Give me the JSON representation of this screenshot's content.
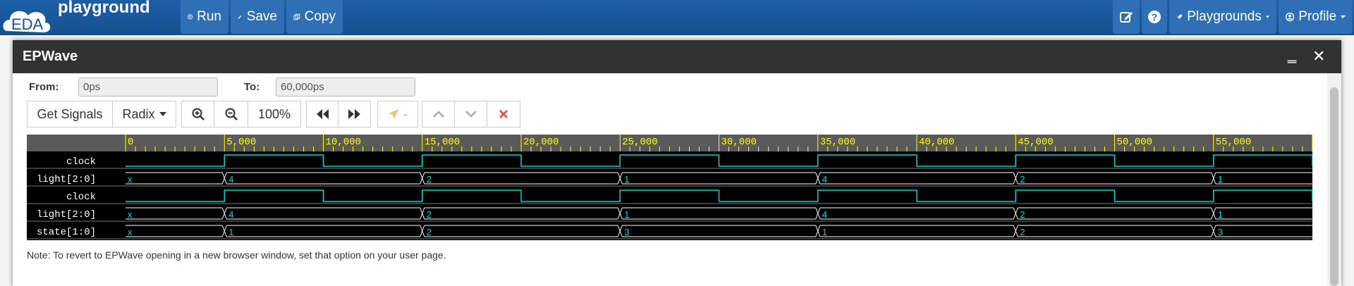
{
  "navbar": {
    "logo_text": "EDA",
    "logo_word": "playground",
    "run_label": "Run",
    "save_label": "Save",
    "copy_label": "Copy",
    "playgrounds_label": "Playgrounds",
    "profile_label": "Profile"
  },
  "modal": {
    "title": "EPWave",
    "minimize_glyph": "‗",
    "close_glyph": "✕",
    "from_label": "From:",
    "from_value": "0ps",
    "to_label": "To:",
    "to_value": "60,000ps",
    "get_signals_label": "Get Signals",
    "radix_label": "Radix",
    "zoom_value": "100%",
    "marker_label": "-",
    "note": "Note: To revert to EPWave opening in a new browser window, set that option on your user page."
  },
  "waveform": {
    "time_max": 60000,
    "ticks": [
      "0",
      "5,000",
      "10,000",
      "15,000",
      "20,000",
      "25,000",
      "30,000",
      "35,000",
      "40,000",
      "45,000",
      "50,000",
      "55,000"
    ],
    "signals": [
      {
        "name": "clock",
        "type": "clock",
        "period": 10000,
        "first_edge": 5000
      },
      {
        "name": "light[2:0]",
        "type": "bus",
        "segments": [
          {
            "t": 0,
            "v": "x"
          },
          {
            "t": 5000,
            "v": "4"
          },
          {
            "t": 15000,
            "v": "2"
          },
          {
            "t": 25000,
            "v": "1"
          },
          {
            "t": 35000,
            "v": "4"
          },
          {
            "t": 45000,
            "v": "2"
          },
          {
            "t": 55000,
            "v": "1"
          }
        ]
      },
      {
        "name": "clock",
        "type": "clock",
        "period": 10000,
        "first_edge": 5000
      },
      {
        "name": "light[2:0]",
        "type": "bus",
        "segments": [
          {
            "t": 0,
            "v": "x"
          },
          {
            "t": 5000,
            "v": "4"
          },
          {
            "t": 15000,
            "v": "2"
          },
          {
            "t": 25000,
            "v": "1"
          },
          {
            "t": 35000,
            "v": "4"
          },
          {
            "t": 45000,
            "v": "2"
          },
          {
            "t": 55000,
            "v": "1"
          }
        ]
      },
      {
        "name": "state[1:0]",
        "type": "bus",
        "segments": [
          {
            "t": 0,
            "v": "x"
          },
          {
            "t": 5000,
            "v": "1"
          },
          {
            "t": 15000,
            "v": "2"
          },
          {
            "t": 25000,
            "v": "3"
          },
          {
            "t": 35000,
            "v": "1"
          },
          {
            "t": 45000,
            "v": "2"
          },
          {
            "t": 55000,
            "v": "3"
          }
        ]
      }
    ],
    "colors": {
      "wave": "#00d4d4",
      "ruler_text": "#ffff00",
      "signal_text": "#ffffff",
      "grid": "#ffffff"
    }
  }
}
